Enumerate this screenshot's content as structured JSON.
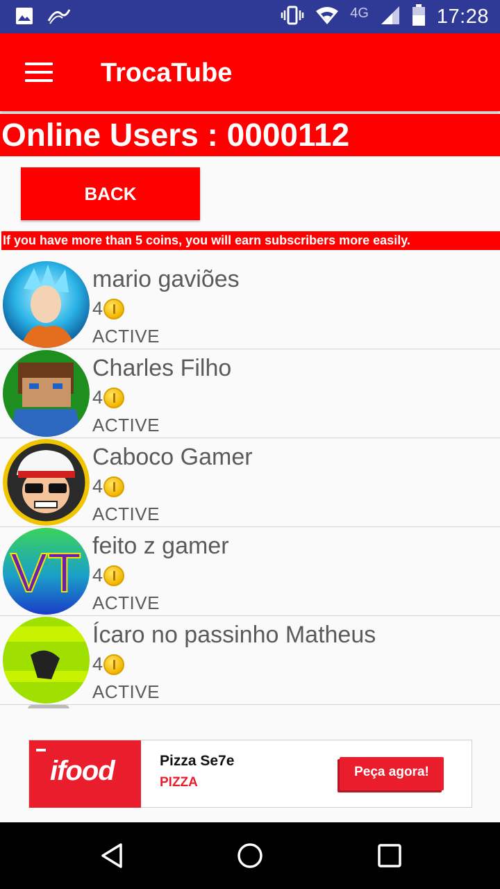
{
  "status_bar": {
    "time": "17:28",
    "network": "4G",
    "icons": [
      "image-icon",
      "swype-icon",
      "vibrate-icon",
      "wifi-icon",
      "signal-icon",
      "battery-icon"
    ]
  },
  "app_bar": {
    "title": "TrocaTube",
    "menu_icon": "hamburger-menu-icon"
  },
  "online_banner": {
    "text": "Online Users : 0000112"
  },
  "back_button": {
    "label": "BACK"
  },
  "tip": {
    "text": "If you have more than 5 coins, you will earn subscribers more easily."
  },
  "users": [
    {
      "name": "mario gaviões",
      "coins": "4",
      "status": "ACTIVE"
    },
    {
      "name": "Charles Filho",
      "coins": "4",
      "status": "ACTIVE"
    },
    {
      "name": "Caboco Gamer",
      "coins": "4",
      "status": "ACTIVE"
    },
    {
      "name": "feito z gamer",
      "coins": "4",
      "status": "ACTIVE"
    },
    {
      "name": "Ícaro no passinho Matheus",
      "coins": "4",
      "status": "ACTIVE"
    }
  ],
  "avatar_text": {
    "user4": "VT"
  },
  "ad": {
    "brand": "ifood",
    "title": "Pizza Se7e",
    "subtitle": "PIZZA",
    "cta": "Peça agora!"
  },
  "colors": {
    "primary_red": "#ff0000",
    "status_bar": "#2f3a96",
    "ifood_red": "#ea1d2c"
  }
}
